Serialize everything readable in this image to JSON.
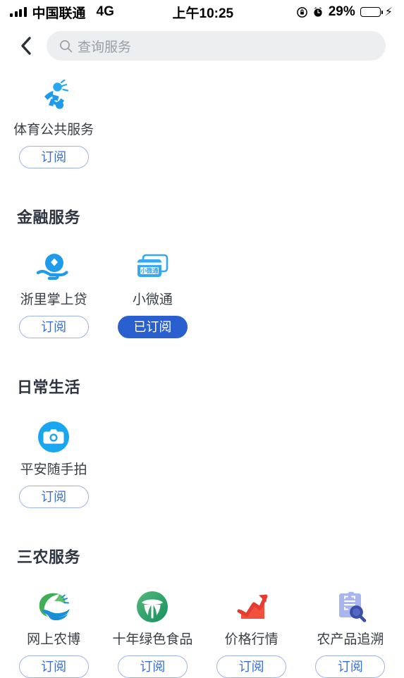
{
  "statusbar": {
    "carrier": "中国联通",
    "network": "4G",
    "time": "上午10:25",
    "battery_percent": "29%",
    "battery_level": 29,
    "icons": [
      "signal-icon",
      "rotation-lock-icon",
      "alarm-icon",
      "battery-icon",
      "charging-bolt-icon"
    ]
  },
  "header": {
    "back_icon": "chevron-left-icon",
    "search_icon": "search-icon",
    "search_placeholder": "查询服务",
    "search_value": ""
  },
  "labels": {
    "subscribe": "订阅",
    "subscribed": "已订阅"
  },
  "colors": {
    "accent_blue": "#2a5fd0",
    "button_border": "#9fb3e8",
    "button_text": "#3b6fd4",
    "search_bg": "#eceef0",
    "title_text": "#2e3542",
    "item_text": "#3a3f47",
    "battery_green": "#3ddc5c"
  },
  "sections": [
    {
      "title": "",
      "items": [
        {
          "name": "体育公共服务",
          "icon": "sports-runner-icon",
          "subscribed": false,
          "button": "订阅"
        }
      ]
    },
    {
      "title": "金融服务",
      "items": [
        {
          "name": "浙里掌上贷",
          "icon": "hand-coin-icon",
          "subscribed": false,
          "button": "订阅"
        },
        {
          "name": "小微通",
          "icon": "credit-card-icon",
          "subscribed": true,
          "button": "已订阅"
        }
      ]
    },
    {
      "title": "日常生活",
      "items": [
        {
          "name": "平安随手拍",
          "icon": "camera-icon",
          "subscribed": false,
          "button": "订阅"
        }
      ]
    },
    {
      "title": "三农服务",
      "items": [
        {
          "name": "网上农博",
          "icon": "leaf-wave-icon",
          "subscribed": false,
          "button": "订阅"
        },
        {
          "name": "十年绿色食品",
          "icon": "green-food-icon",
          "subscribed": false,
          "button": "订阅"
        },
        {
          "name": "价格行情",
          "icon": "price-chart-icon",
          "subscribed": false,
          "button": "订阅"
        },
        {
          "name": "农产品追溯",
          "icon": "traceability-scan-icon",
          "subscribed": false,
          "button": "订阅"
        }
      ]
    }
  ]
}
